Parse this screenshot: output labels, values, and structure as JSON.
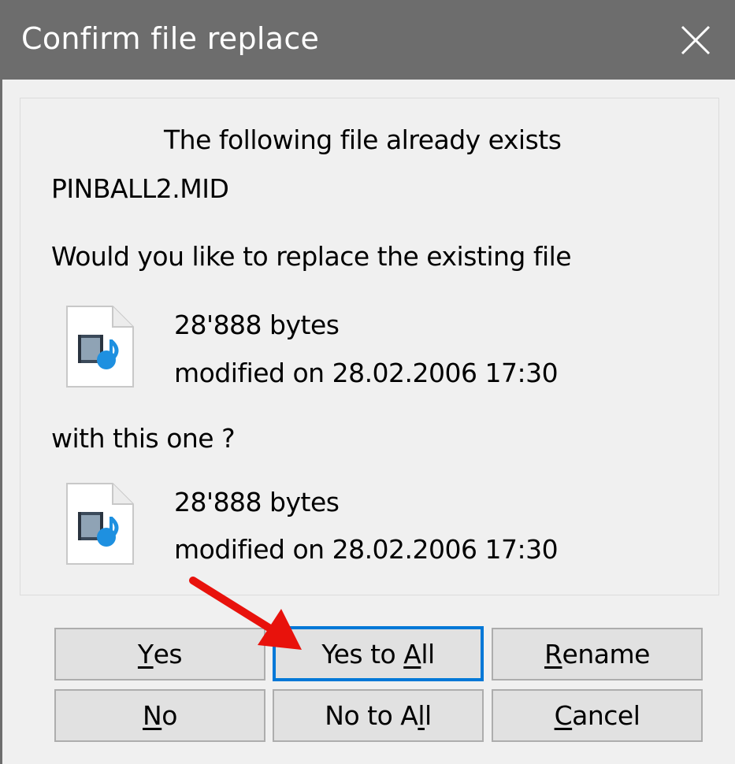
{
  "window": {
    "title": "Confirm file replace"
  },
  "message": {
    "line1": "The following file already exists",
    "filename": "PINBALL2.MID",
    "question": "Would you like to replace the existing file",
    "with_this": "with this one ?"
  },
  "existing_file": {
    "size": "28'888 bytes",
    "modified": "modified on 28.02.2006 17:30",
    "icon": "media-file-icon"
  },
  "new_file": {
    "size": "28'888 bytes",
    "modified": "modified on 28.02.2006 17:30",
    "icon": "media-file-icon"
  },
  "buttons": {
    "yes": {
      "mnemonic": "Y",
      "rest": "es"
    },
    "yes_to_all": {
      "prefix": "Yes to ",
      "mnemonic": "A",
      "rest": "ll"
    },
    "rename": {
      "mnemonic": "R",
      "rest": "ename"
    },
    "no": {
      "mnemonic": "N",
      "rest": "o"
    },
    "no_to_all": {
      "prefix": "No to A",
      "mnemonic": "l",
      "rest": "l"
    },
    "cancel": {
      "mnemonic": "C",
      "rest": "ancel"
    }
  },
  "default_button": "yes_to_all",
  "annotation": {
    "arrow_color": "#e8120c",
    "icon": "red-arrow-icon"
  },
  "colors": {
    "titlebar": "#6d6d6d",
    "focus": "#0078d7",
    "background": "#f0f0f0"
  }
}
